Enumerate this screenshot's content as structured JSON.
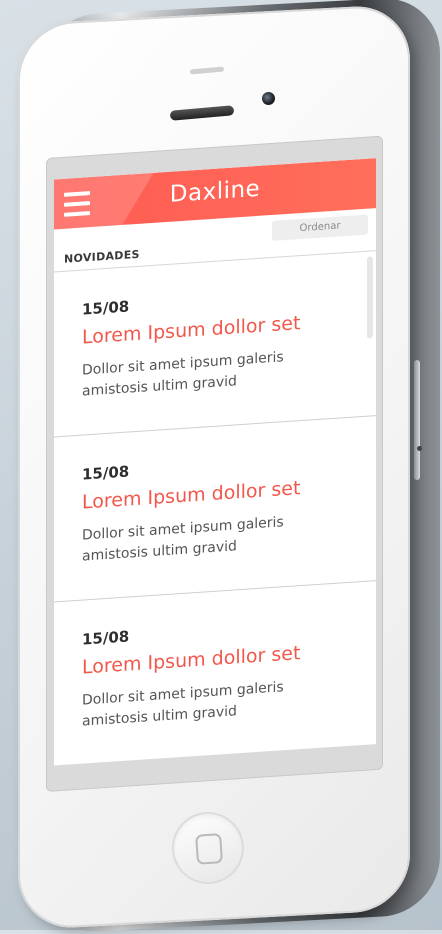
{
  "app": {
    "title": "Daxline",
    "sort_label": "Ordenar",
    "section_label": "NOVIDADES"
  },
  "items": [
    {
      "date": "15/08",
      "title": "Lorem Ipsum dollor set",
      "text": "Dollor sit amet ipsum galeris amistosis ultim gravid"
    },
    {
      "date": "15/08",
      "title": "Lorem Ipsum dollor set",
      "text": "Dollor sit amet ipsum galeris amistosis ultim gravid"
    },
    {
      "date": "15/08",
      "title": "Lorem Ipsum dollor set",
      "text": "Dollor sit amet ipsum galeris amistosis ultim gravid"
    }
  ],
  "colors": {
    "accent": "#ff5a52",
    "title_text": "#f2574b"
  },
  "icons": {
    "menu": "hamburger-menu-icon",
    "home": "home-button-icon"
  }
}
